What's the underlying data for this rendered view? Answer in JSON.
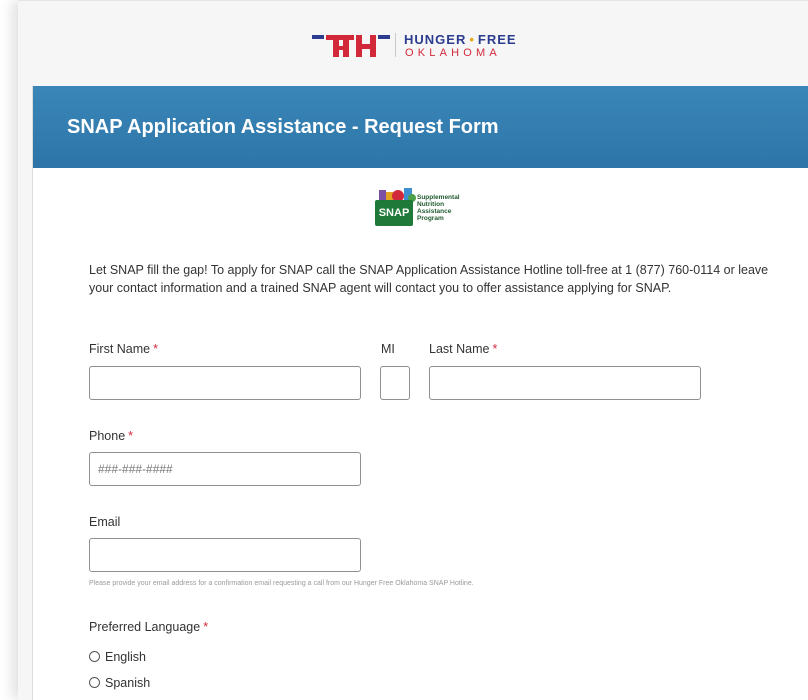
{
  "brand": {
    "mark": "HFO",
    "name_top_left": "HUNGER",
    "name_top_sep": "•",
    "name_top_right": "FREE",
    "name_bottom": "OKLAHOMA",
    "colors": {
      "blue": "#2c3c8e",
      "red": "#d2293a",
      "gold": "#e8a91c"
    }
  },
  "form": {
    "title": "SNAP Application Assistance - Request Form",
    "header_color": "#2d75a8",
    "snap_logo": {
      "box_text": "SNAP",
      "lines": [
        "Supplemental",
        "Nutrition",
        "Assistance",
        "Program"
      ]
    },
    "intro": "Let SNAP fill the gap! To apply for SNAP call the SNAP Application Assistance Hotline toll-free at 1 (877) 760-0114 or leave your contact information and a trained SNAP agent will contact you to offer assistance applying for SNAP.",
    "required_marker": "*",
    "fields": {
      "first_name": {
        "label": "First Name",
        "value": ""
      },
      "mi": {
        "label": "MI",
        "value": ""
      },
      "last_name": {
        "label": "Last Name",
        "value": ""
      },
      "phone": {
        "label": "Phone",
        "placeholder": "###-###-####",
        "value": ""
      },
      "email": {
        "label": "Email",
        "value": "",
        "help": "Please provide your email address for a confirmation email requesting a call from our Hunger Free Oklahoma SNAP Hotline."
      }
    },
    "preferred_language": {
      "label": "Preferred Language",
      "options": [
        "English",
        "Spanish"
      ]
    }
  }
}
